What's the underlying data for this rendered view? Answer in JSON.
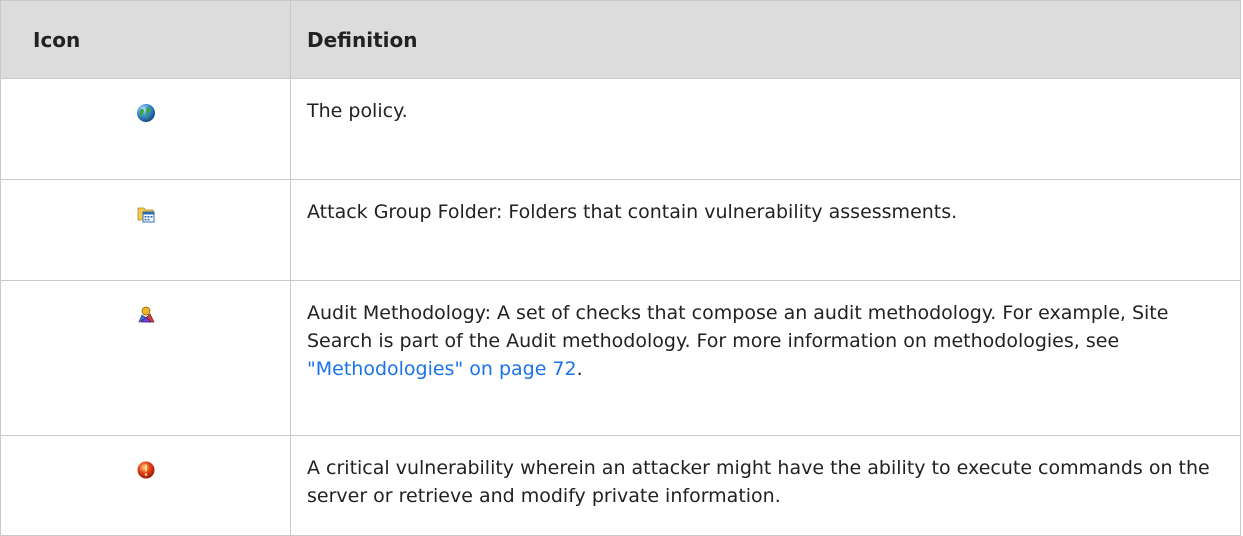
{
  "table": {
    "headers": {
      "icon": "Icon",
      "definition": "Definition"
    },
    "rows": [
      {
        "icon": "globe-icon",
        "definition": "The policy."
      },
      {
        "icon": "attack-group-folder-icon",
        "definition": "Attack Group Folder: Folders that contain vulnerability assessments."
      },
      {
        "icon": "audit-methodology-icon",
        "definition_prefix": "Audit Methodology: A set of checks that compose an audit methodology. For example, Site Search is part of the Audit methodology. For more information on methodologies, see ",
        "link_text": "\"Methodologies\" on page 72",
        "definition_suffix": "."
      },
      {
        "icon": "critical-vulnerability-icon",
        "definition": "A critical vulnerability wherein an attacker might have the ability to execute commands on the server or retrieve and modify private information."
      }
    ]
  },
  "colors": {
    "header_bg": "#dcdcdc",
    "border": "#c9c9c9",
    "link": "#1a73e8"
  }
}
